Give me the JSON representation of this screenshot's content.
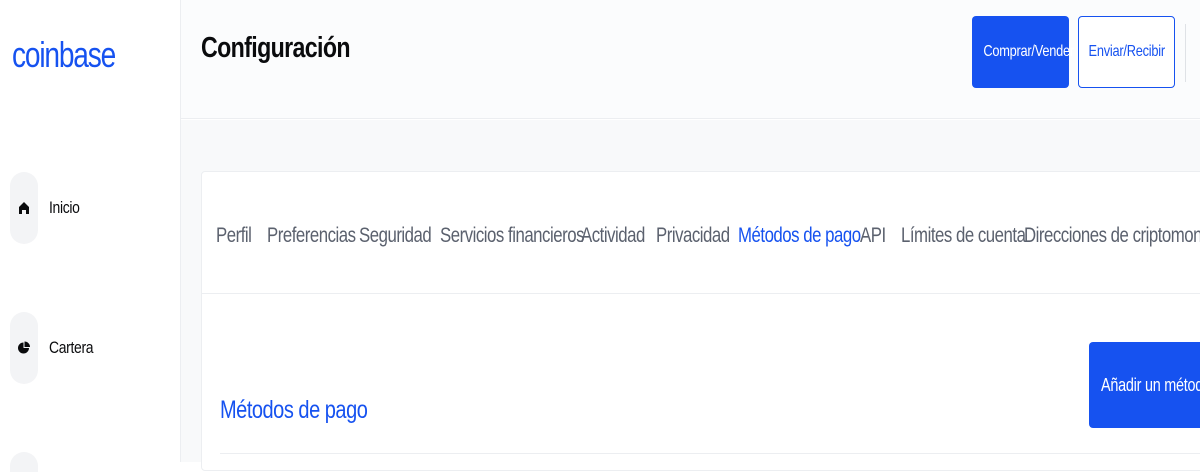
{
  "brand": {
    "logo_text": "coinbase",
    "accent_color": "#1652f0"
  },
  "sidebar": {
    "items": [
      {
        "label": "Inicio",
        "icon": "home-icon"
      },
      {
        "label": "Cartera",
        "icon": "pie-chart-icon"
      }
    ]
  },
  "header": {
    "title": "Configuración",
    "buy_sell_label": "Comprar/Vender",
    "send_receive_label": "Enviar/Recibir"
  },
  "settings": {
    "tabs": [
      {
        "label": "Perfil",
        "active": false
      },
      {
        "label": "Preferencias",
        "active": false
      },
      {
        "label": "Seguridad",
        "active": false
      },
      {
        "label": "Servicios financieros",
        "active": false
      },
      {
        "label": "Actividad",
        "active": false
      },
      {
        "label": "Privacidad",
        "active": false
      },
      {
        "label": "Métodos de pago",
        "active": true
      },
      {
        "label": "API",
        "active": false
      },
      {
        "label": "Límites de cuenta",
        "active": false
      },
      {
        "label": "Direcciones de criptomonedas",
        "active": false
      }
    ],
    "section_title": "Métodos de pago",
    "add_button_label": "Añadir un método de pago"
  }
}
